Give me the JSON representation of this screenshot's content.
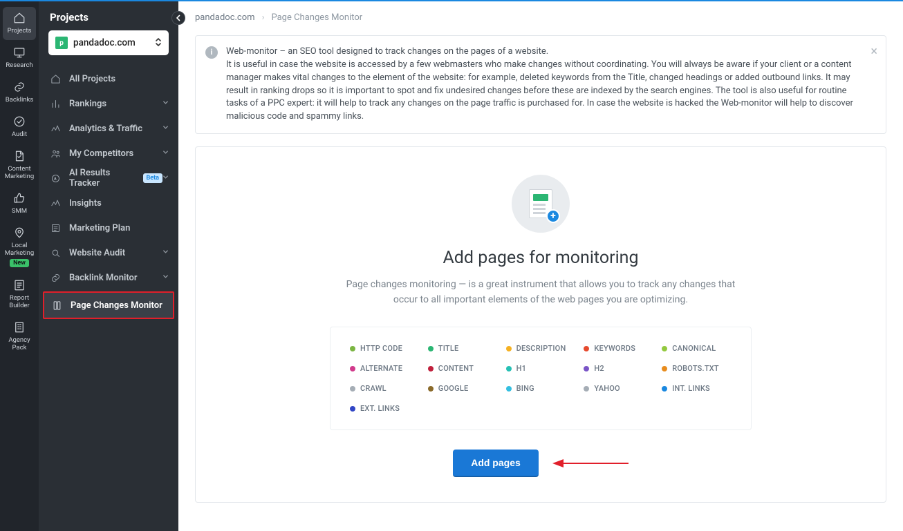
{
  "iconrail": [
    {
      "label": "Projects",
      "icon": "home",
      "active": true
    },
    {
      "label": "Research",
      "icon": "screen"
    },
    {
      "label": "Backlinks",
      "icon": "link"
    },
    {
      "label": "Audit",
      "icon": "check"
    },
    {
      "label": "Content\nMarketing",
      "icon": "doc"
    },
    {
      "label": "SMM",
      "icon": "thumb"
    },
    {
      "label": "Local\nMarketing",
      "icon": "pin",
      "badge": "New"
    },
    {
      "label": "Report\nBuilder",
      "icon": "report"
    },
    {
      "label": "Agency\nPack",
      "icon": "building"
    }
  ],
  "sidebar": {
    "title": "Projects",
    "project_name": "pandadoc.com",
    "items": [
      {
        "label": "All Projects",
        "icon": "home",
        "expandable": false
      },
      {
        "label": "Rankings",
        "icon": "bars",
        "expandable": true
      },
      {
        "label": "Analytics & Traffic",
        "icon": "wave",
        "expandable": true
      },
      {
        "label": "My Competitors",
        "icon": "people",
        "expandable": true
      },
      {
        "label": "AI Results Tracker",
        "icon": "ai",
        "expandable": true,
        "beta": "Beta"
      },
      {
        "label": "Insights",
        "icon": "spark",
        "expandable": false
      },
      {
        "label": "Marketing Plan",
        "icon": "plan",
        "expandable": false
      },
      {
        "label": "Website Audit",
        "icon": "magnify",
        "expandable": true
      },
      {
        "label": "Backlink Monitor",
        "icon": "chain",
        "expandable": true
      },
      {
        "label": "Page Changes Monitor",
        "icon": "pages",
        "expandable": false,
        "highlight": true
      }
    ]
  },
  "breadcrumb": {
    "root": "pandadoc.com",
    "current": "Page Changes Monitor"
  },
  "info": {
    "lead": "Web-monitor – an SEO tool designed to track changes on the pages of a website.",
    "body": "It is useful in case the website is accessed by a few webmasters who make changes without coordinating. You will always be aware if your client or a content manager makes vital changes to the element of the website: for example, deleted keywords from the Title, changed headings or added outbound links. It may result in ranking drops so it is important to spot and fix undesired changes before these are indexed by the search engines. The tool is also useful for routine tasks of a PPC expert: it will help to track any changes on the page traffic is purchased for. In case the website is hacked the Web-monitor will help to discover malicious code and spammy links."
  },
  "empty": {
    "title": "Add pages for monitoring",
    "subtitle": "Page changes monitoring — is a great instrument that allows you to track any changes that occur to all important elements of the web pages you are optimizing."
  },
  "tags": [
    {
      "label": "HTTP CODE",
      "color": "#7bb542"
    },
    {
      "label": "TITLE",
      "color": "#2bb673"
    },
    {
      "label": "DESCRIPTION",
      "color": "#f5b122"
    },
    {
      "label": "KEYWORDS",
      "color": "#e64a2e"
    },
    {
      "label": "CANONICAL",
      "color": "#93c93f"
    },
    {
      "label": "ALTERNATE",
      "color": "#d13a8b"
    },
    {
      "label": "CONTENT",
      "color": "#c0203c"
    },
    {
      "label": "H1",
      "color": "#26c0b4"
    },
    {
      "label": "H2",
      "color": "#7a55c7"
    },
    {
      "label": "ROBOTS.TXT",
      "color": "#e88c1e"
    },
    {
      "label": "CRAWL",
      "color": "#a5adb5"
    },
    {
      "label": "GOOGLE",
      "color": "#8a6a2a"
    },
    {
      "label": "BING",
      "color": "#34bfe0"
    },
    {
      "label": "YAHOO",
      "color": "#a5adb5"
    },
    {
      "label": "INT. LINKS",
      "color": "#1a88e0"
    },
    {
      "label": "EXT. LINKS",
      "color": "#3146c5"
    }
  ],
  "cta": {
    "label": "Add pages"
  }
}
